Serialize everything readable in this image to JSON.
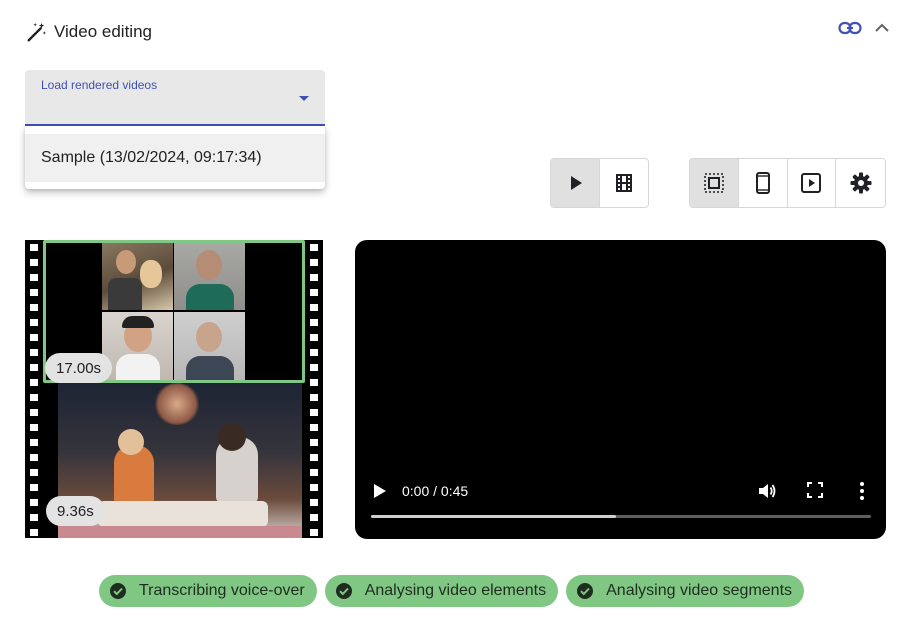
{
  "panel": {
    "title": "Video editing",
    "icons": {
      "title_icon": "magic-wand-icon",
      "link": "link-icon",
      "collapse": "chevron-up-icon"
    }
  },
  "video_select": {
    "label": "Load rendered videos",
    "value": "",
    "options": [
      "Sample (13/02/2024, 09:17:34)"
    ]
  },
  "view_toggle": {
    "items": [
      {
        "icon": "play-icon",
        "active": true
      },
      {
        "icon": "film-icon",
        "active": false
      }
    ]
  },
  "format_toggle": {
    "items": [
      {
        "icon": "select-all-icon",
        "active": true
      },
      {
        "icon": "smartphone-icon",
        "active": false
      },
      {
        "icon": "slideshow-icon",
        "active": false
      },
      {
        "icon": "settings-icon",
        "active": false
      }
    ]
  },
  "filmstrip": {
    "segments": [
      {
        "duration": "17.00s",
        "selected": true
      },
      {
        "duration": "9.36s",
        "selected": false
      }
    ]
  },
  "player": {
    "time": "0:00 / 0:45",
    "buffered_fraction": 0.49,
    "colors": {
      "background": "#000000",
      "track": "#5f5f5f",
      "buffer": "#cfcfcf"
    }
  },
  "status": {
    "items": [
      {
        "label": "Transcribing voice-over",
        "done": true
      },
      {
        "label": "Analysing video elements",
        "done": true
      },
      {
        "label": "Analysing video segments",
        "done": true
      }
    ],
    "color": "#81c784"
  },
  "colors": {
    "accent": "#3f51b5",
    "selected_frame": "#81c784",
    "field_bg": "#e8e8e8"
  }
}
